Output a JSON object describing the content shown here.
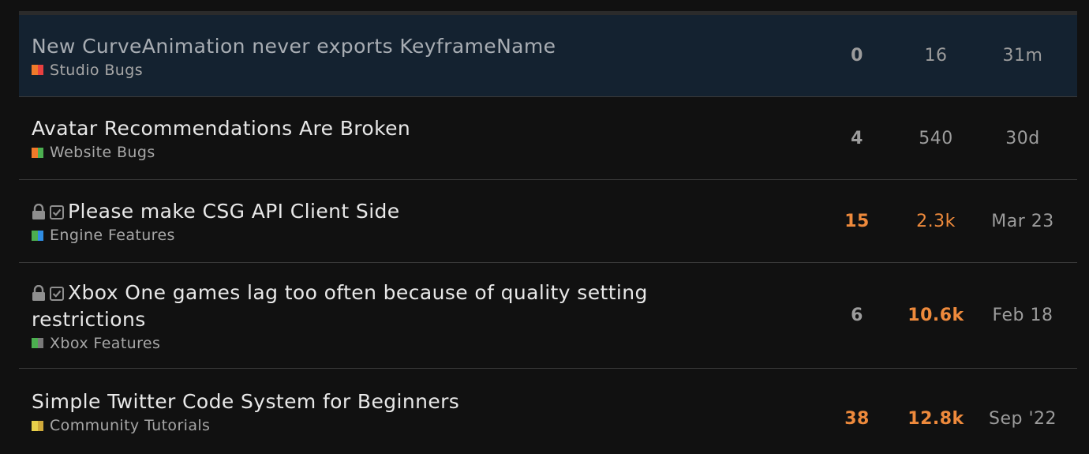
{
  "topics": [
    {
      "title": "New CurveAnimation never exports KeyframeName",
      "category": "Studio Bugs",
      "category_colors": [
        "#f07a2a",
        "#e84040"
      ],
      "replies": "0",
      "views": "16",
      "activity": "31m",
      "highlighted": true
    },
    {
      "title": "Avatar Recommendations Are Broken",
      "category": "Website Bugs",
      "category_colors": [
        "#f07a2a",
        "#4caf50"
      ],
      "replies": "4",
      "views": "540",
      "activity": "30d"
    },
    {
      "title": "Please make CSG API Client Side",
      "category": "Engine Features",
      "category_colors": [
        "#4caf50",
        "#2f8de4"
      ],
      "replies": "15",
      "views": "2.3k",
      "activity": "Mar 23",
      "icons": [
        "lock-icon",
        "checkbox-icon"
      ]
    },
    {
      "title": "Xbox One games lag too often because of quality setting restrictions",
      "category": "Xbox Features",
      "category_colors": [
        "#4caf50",
        "#7a7a7a"
      ],
      "replies": "6",
      "views": "10.6k",
      "activity": "Feb 18",
      "icons": [
        "lock-icon",
        "checkbox-icon"
      ]
    },
    {
      "title": "Simple Twitter Code System for Beginners",
      "category": "Community Tutorials",
      "category_colors": [
        "#e8d04a",
        "#cfa93a"
      ],
      "replies": "38",
      "views": "12.8k",
      "activity": "Sep '22"
    }
  ],
  "colors": {
    "background": "#111111",
    "highlight_row": "#142230",
    "divider": "#3a3a3a",
    "hot_metric": "#ee8a3c",
    "muted_text": "#9c9c9c"
  }
}
